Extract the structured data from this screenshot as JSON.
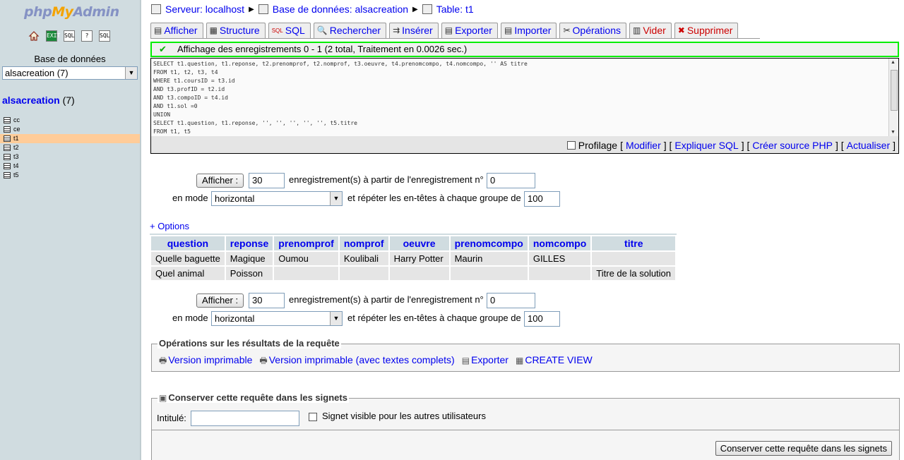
{
  "left": {
    "logo": {
      "part1": "php",
      "part2": "My",
      "part3": "Admin"
    },
    "icons": [
      "home-icon",
      "exit-icon",
      "sql-icon",
      "query-icon",
      "doc-icon"
    ],
    "icon_labels": {
      "exit": "EXIT",
      "sql": "SQL",
      "q": "?",
      "doc": "SQL"
    },
    "db_label": "Base de données",
    "db_select": "alsacreation (7)",
    "db_link": "alsacreation",
    "db_count": "(7)",
    "tables": [
      "cc",
      "ce",
      "t1",
      "t2",
      "t3",
      "t4",
      "t5"
    ],
    "active_table": "t1"
  },
  "breadcrumb": {
    "server": "Serveur: localhost",
    "database": "Base de données: alsacreation",
    "table": "Table: t1"
  },
  "tabs": [
    {
      "label": "Afficher",
      "icon": "browse-icon"
    },
    {
      "label": "Structure",
      "icon": "structure-icon"
    },
    {
      "label": "SQL",
      "icon": "sql-icon"
    },
    {
      "label": "Rechercher",
      "icon": "search-icon"
    },
    {
      "label": "Insérer",
      "icon": "insert-icon"
    },
    {
      "label": "Exporter",
      "icon": "export-icon"
    },
    {
      "label": "Importer",
      "icon": "import-icon"
    },
    {
      "label": "Opérations",
      "icon": "operations-icon"
    },
    {
      "label": "Vider",
      "icon": "empty-icon"
    },
    {
      "label": "Supprimer",
      "icon": "drop-icon"
    }
  ],
  "success_message": "Affichage des enregistrements 0 - 1 (2 total, Traitement en 0.0026 sec.)",
  "sql_query": "SELECT t1.question, t1.reponse, t2.prenomprof, t2.nomprof, t3.oeuvre, t4.prenomcompo, t4.nomcompo, '' AS titre\nFROM t1, t2, t3, t4\nWHERE t1.coursID = t3.id\nAND t3.profID = t2.id\nAND t3.compoID = t4.id\nAND t1.sol =0\nUNION\nSELECT t1.question, t1.reponse, '', '', '', '', '', t5.titre\nFROM t1, t5",
  "sql_actions": {
    "profiling": "Profilage",
    "edit": "Modifier",
    "explain": "Expliquer SQL",
    "php": "Créer source PHP",
    "refresh": "Actualiser"
  },
  "navform": {
    "show_button": "Afficher :",
    "rows": "30",
    "from_label": "enregistrement(s) à partir de l'enregistrement n°",
    "from_value": "0",
    "mode_label": "en mode",
    "mode_value": "horizontal",
    "repeat_label": "et répéter les en-têtes à chaque groupe de",
    "repeat_value": "100"
  },
  "options_link": "+ Options",
  "results": {
    "columns": [
      "question",
      "reponse",
      "prenomprof",
      "nomprof",
      "oeuvre",
      "prenomcompo",
      "nomcompo",
      "titre"
    ],
    "rows": [
      [
        "Quelle baguette",
        "Magique",
        "Oumou",
        "Koulibali",
        "Harry Potter",
        "Maurin",
        "GILLES",
        ""
      ],
      [
        "Quel animal",
        "Poisson",
        "",
        "",
        "",
        "",
        "",
        "Titre de la solution"
      ]
    ]
  },
  "query_ops": {
    "legend": "Opérations sur les résultats de la requête",
    "print": "Version imprimable",
    "print_full": "Version imprimable (avec textes complets)",
    "export": "Exporter",
    "create_view": "CREATE VIEW"
  },
  "bookmark": {
    "legend": "Conserver cette requête dans les signets",
    "label": "Intitulé:",
    "visible_label": "Signet visible pour les autres utilisateurs",
    "submit": "Conserver cette requête dans les signets"
  }
}
